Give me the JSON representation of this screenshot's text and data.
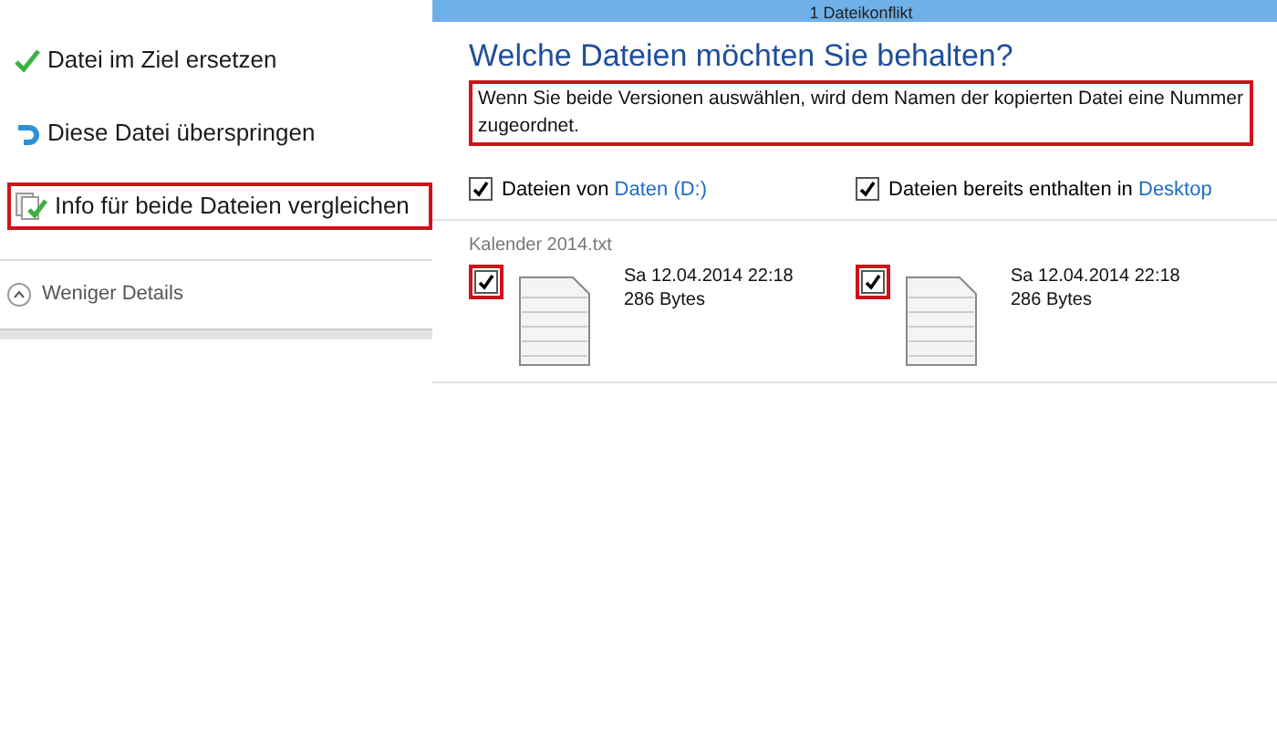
{
  "window": {
    "title": "1 Dateikonflikt"
  },
  "options": [
    {
      "kind": "replace",
      "label": "Datei im Ziel ersetzen",
      "highlighted": false
    },
    {
      "kind": "skip",
      "label": "Diese Datei überspringen",
      "highlighted": false
    },
    {
      "kind": "compare",
      "label": "Info für beide Dateien vergleichen",
      "highlighted": true
    }
  ],
  "details_toggle": {
    "label": "Weniger Details",
    "expanded": true
  },
  "dialog": {
    "heading": "Welche Dateien möchten Sie behalten?",
    "description": "Wenn Sie beide Versionen auswählen, wird dem Namen der kopierten Datei eine Nummer zugeordnet.",
    "description_highlighted": true,
    "sources": [
      {
        "label": "Dateien von",
        "location": "Daten (D:)",
        "checked": true
      },
      {
        "label": "Dateien bereits enthalten in",
        "location": "Desktop",
        "checked": true
      }
    ],
    "file_name": "Kalender 2014.txt",
    "versions": [
      {
        "date": "Sa 12.04.2014 22:18",
        "size": "286 Bytes",
        "checked": true,
        "highlighted": true
      },
      {
        "date": "Sa 12.04.2014 22:18",
        "size": "286 Bytes",
        "checked": true,
        "highlighted": true
      }
    ]
  }
}
